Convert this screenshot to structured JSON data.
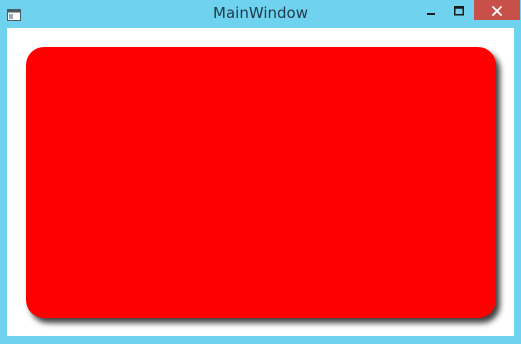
{
  "window": {
    "title": "MainWindow",
    "icons": {
      "system": "window-icon",
      "minimize": "minimize-icon",
      "maximize": "maximize-icon",
      "close": "close-icon"
    },
    "colors": {
      "frame": "#6fd2ee",
      "close_button": "#c7504a",
      "client_background": "#ffffff"
    }
  },
  "content": {
    "card": {
      "fill_color": "#ff0000"
    }
  }
}
